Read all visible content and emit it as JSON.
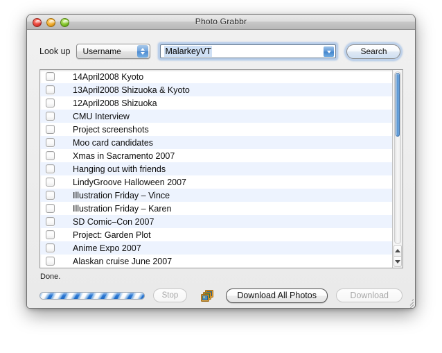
{
  "window": {
    "title": "Photo Grabbr",
    "controls": [
      {
        "name": "close",
        "color": "#e8433a"
      },
      {
        "name": "minimize",
        "color": "#f0ab29"
      },
      {
        "name": "zoom",
        "color": "#81c328"
      }
    ]
  },
  "toolbar": {
    "lookup_label": "Look up",
    "lookup_type": {
      "value": "Username",
      "options": [
        "Username"
      ]
    },
    "query": {
      "value": "MalarkeyVT",
      "placeholder": ""
    },
    "search_label": "Search"
  },
  "list": {
    "items": [
      {
        "label": "14April2008 Kyoto",
        "checked": false
      },
      {
        "label": "13April2008 Shizuoka & Kyoto",
        "checked": false
      },
      {
        "label": "12April2008 Shizuoka",
        "checked": false
      },
      {
        "label": "CMU Interview",
        "checked": false
      },
      {
        "label": "Project screenshots",
        "checked": false
      },
      {
        "label": "Moo card candidates",
        "checked": false
      },
      {
        "label": "Xmas in Sacramento 2007",
        "checked": false
      },
      {
        "label": "Hanging out with friends",
        "checked": false
      },
      {
        "label": "LindyGroove Halloween 2007",
        "checked": false
      },
      {
        "label": "Illustration Friday – Vince",
        "checked": false
      },
      {
        "label": "Illustration Friday – Karen",
        "checked": false
      },
      {
        "label": "SD Comic–Con 2007",
        "checked": false
      },
      {
        "label": "Project: Garden Plot",
        "checked": false
      },
      {
        "label": "Anime Expo 2007",
        "checked": false
      },
      {
        "label": "Alaskan cruise June 2007",
        "checked": false
      }
    ],
    "scrollbar": {
      "thumb_position": "top",
      "up_arrow": "triangle-up",
      "down_arrow": "triangle-down"
    }
  },
  "status": {
    "message": "Done.",
    "progress": {
      "style": "indeterminate-barber-pole",
      "percent": 100
    },
    "stop_label": "Stop",
    "stop_enabled": false,
    "photo_icon": "stacked-photos-icon",
    "download_all_label": "Download All Photos",
    "download_all_enabled": true,
    "download_label": "Download",
    "download_enabled": false
  },
  "colors": {
    "accent": "#3f82c9",
    "row_alt": "#edf3fe",
    "window_bg": "#ededed",
    "selection": "#cfe0f5"
  }
}
